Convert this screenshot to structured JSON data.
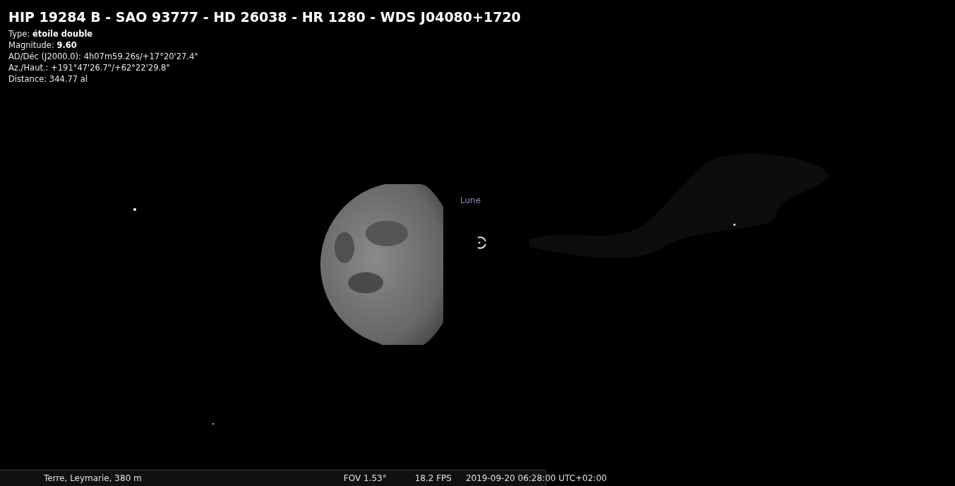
{
  "object_info": {
    "title": "HIP 19284 B - SAO 93777 - HD 26038 - HR 1280 - WDS J04080+1720",
    "lines": [
      "Type: **étoile double**",
      "Magnitude: **9.60**",
      "AD/Déc (J2000.0): 4h07m59.26s/+17°20'27.4\"",
      "Az./Haut.: +191°47'26.7\"/+62°22'29.8\"",
      "Distance: 344.77 al"
    ]
  },
  "sky": {
    "moon_label": "Lune"
  },
  "status_bar": {
    "location": "Terre, Leymarie, 380 m",
    "fov": "FOV 1.53°",
    "fps": "18.2 FPS",
    "datetime": "2019-09-20 06:28:00 UTC+02:00"
  }
}
